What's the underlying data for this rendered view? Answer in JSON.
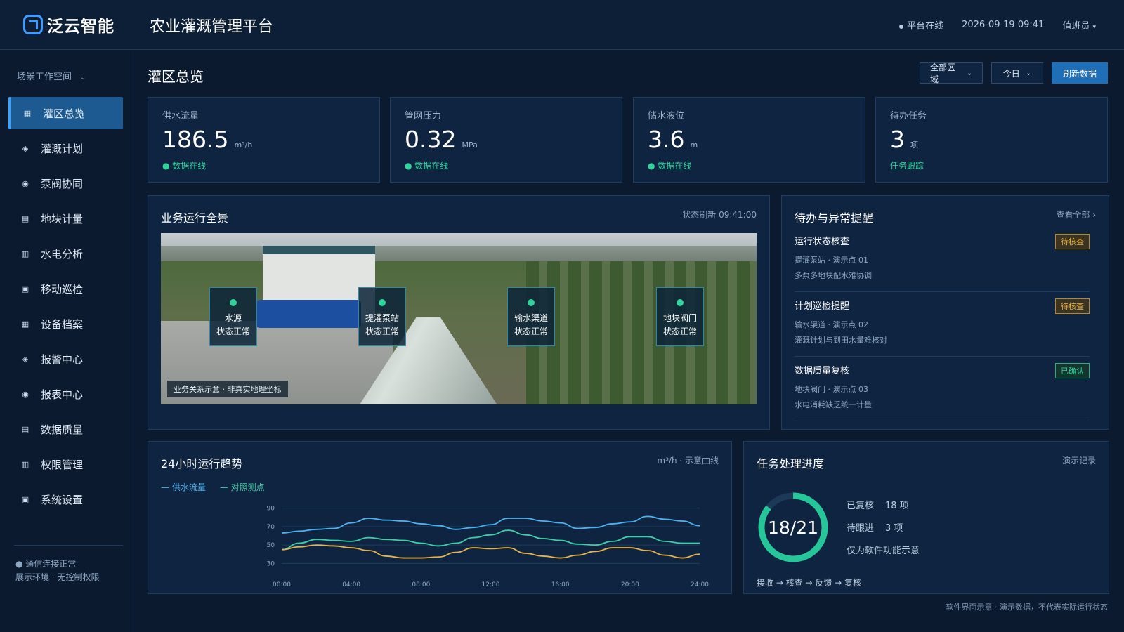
{
  "header": {
    "brand": "泛云智能",
    "title": "农业灌溉管理平台",
    "status": "平台在线",
    "datetime": "2026-09-19 09:41",
    "user": "值班员",
    "user_chevron": "▾"
  },
  "sidebar": {
    "workspace": "场景工作空间",
    "workspace_chevron": "⌄",
    "items": [
      {
        "label": "灌区总览",
        "icon": "▦",
        "icon_name": "grid-icon",
        "active": true
      },
      {
        "label": "灌溉计划",
        "icon": "◈",
        "icon_name": "diamond-icon"
      },
      {
        "label": "泵阀协同",
        "icon": "◉",
        "icon_name": "target-icon"
      },
      {
        "label": "地块计量",
        "icon": "▤",
        "icon_name": "list-icon"
      },
      {
        "label": "水电分析",
        "icon": "▥",
        "icon_name": "columns-icon"
      },
      {
        "label": "移动巡检",
        "icon": "▣",
        "icon_name": "square-icon"
      },
      {
        "label": "设备档案",
        "icon": "▦",
        "icon_name": "grid-icon"
      },
      {
        "label": "报警中心",
        "icon": "◈",
        "icon_name": "diamond-icon"
      },
      {
        "label": "报表中心",
        "icon": "◉",
        "icon_name": "target-icon"
      },
      {
        "label": "数据质量",
        "icon": "▤",
        "icon_name": "list-icon"
      },
      {
        "label": "权限管理",
        "icon": "▥",
        "icon_name": "columns-icon"
      },
      {
        "label": "系统设置",
        "icon": "▣",
        "icon_name": "square-icon"
      }
    ],
    "footer_status": "通信连接正常",
    "footer_env": "展示环境 · 无控制权限"
  },
  "page": {
    "title": "灌区总览",
    "filter_region": "全部区域",
    "filter_time": "今日",
    "chevron": "⌄",
    "refresh": "刷新数据"
  },
  "kpis": [
    {
      "label": "供水流量",
      "value": "186.5",
      "unit": "m³/h",
      "status": "● 数据在线"
    },
    {
      "label": "管网压力",
      "value": "0.32",
      "unit": "MPa",
      "status": "● 数据在线"
    },
    {
      "label": "储水液位",
      "value": "3.6",
      "unit": "m",
      "status": "● 数据在线"
    },
    {
      "label": "待办任务",
      "value": "3",
      "unit": "项",
      "status": "任务跟踪"
    }
  ],
  "overview": {
    "title": "业务运行全景",
    "meta": "状态刷新 09:41:00",
    "caption": "业务关系示意 · 非真实地理坐标",
    "nodes": [
      {
        "name": "水源",
        "status": "状态正常"
      },
      {
        "name": "提灌泵站",
        "status": "状态正常"
      },
      {
        "name": "输水渠道",
        "status": "状态正常"
      },
      {
        "name": "地块阀门",
        "status": "状态正常"
      }
    ]
  },
  "alerts": {
    "title": "待办与异常提醒",
    "view_all": "查看全部 ›",
    "items": [
      {
        "title": "运行状态核查",
        "line1": "提灌泵站 · 演示点 01",
        "line2": "多泵多地块配水难协调",
        "badge": "待核查"
      },
      {
        "title": "计划巡检提醒",
        "line1": "输水渠道 · 演示点 02",
        "line2": "灌溉计划与到田水量难核对",
        "badge": "待核查"
      },
      {
        "title": "数据质量复核",
        "line1": "地块阀门 · 演示点 03",
        "line2": "水电消耗缺乏统一计量",
        "badge": "已确认"
      }
    ]
  },
  "trend": {
    "title": "24小时运行趋势",
    "meta": "m³/h · 示意曲线",
    "legend": [
      "— 供水流量",
      "— 对照测点"
    ]
  },
  "chart_data": {
    "type": "line",
    "title": "24小时运行趋势",
    "x": [
      "00:00",
      "01:00",
      "02:00",
      "03:00",
      "04:00",
      "05:00",
      "06:00",
      "07:00",
      "08:00",
      "09:00",
      "10:00",
      "11:00",
      "12:00",
      "13:00",
      "14:00",
      "15:00",
      "16:00",
      "17:00",
      "18:00",
      "19:00",
      "20:00",
      "21:00",
      "22:00",
      "23:00",
      "24:00"
    ],
    "x_ticks": [
      "00:00",
      "04:00",
      "08:00",
      "12:00",
      "16:00",
      "20:00",
      "24:00"
    ],
    "y_ticks": [
      30,
      50,
      70,
      90
    ],
    "ylim": [
      25,
      95
    ],
    "series": [
      {
        "name": "供水流量",
        "color": "#4db3f0",
        "values": [
          63,
          65,
          67,
          68,
          74,
          79,
          77,
          76,
          73,
          71,
          67,
          69,
          72,
          79,
          79,
          76,
          74,
          68,
          69,
          73,
          75,
          81,
          78,
          76,
          71
        ]
      },
      {
        "name": "对照测点",
        "color": "#3ecfa8",
        "values": [
          45,
          52,
          56,
          55,
          54,
          58,
          56,
          55,
          52,
          49,
          52,
          58,
          61,
          66,
          61,
          57,
          55,
          51,
          50,
          54,
          59,
          59,
          54,
          52,
          52
        ]
      },
      {
        "name": "",
        "color": "#e6b44a",
        "values": [
          45,
          48,
          50,
          49,
          47,
          44,
          38,
          36,
          36,
          37,
          42,
          47,
          46,
          47,
          41,
          38,
          36,
          39,
          43,
          47,
          47,
          44,
          39,
          36,
          40
        ]
      }
    ],
    "grid": true,
    "legend": "top-left"
  },
  "tasks": {
    "title": "任务处理进度",
    "meta": "演示记录",
    "progress_text": "18/21",
    "done": 18,
    "total": 21,
    "ring_color": "#25c69a",
    "stat1_label": "已复核",
    "stat1_value": "18 项",
    "stat2_label": "待跟进",
    "stat2_value": "3 项",
    "note": "仅为软件功能示意",
    "flow": "接收 → 核查 → 反馈 → 复核"
  },
  "footer_note": "软件界面示意 · 演示数据，不代表实际运行状态"
}
